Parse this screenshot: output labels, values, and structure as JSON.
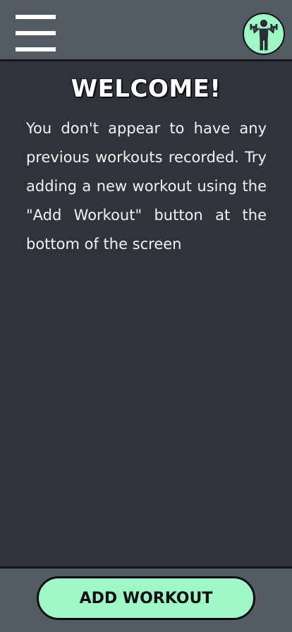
{
  "colors": {
    "header_bg": "#545b62",
    "content_bg": "#2f343b",
    "accent": "#a0f7c6",
    "text": "#ffffff",
    "border": "#15181c"
  },
  "header": {
    "menu_icon": "hamburger-menu-icon",
    "avatar_icon": "weightlifter-icon"
  },
  "main": {
    "title": "WELCOME!",
    "message": "You don't appear to have any previous workouts recorded. Try adding a new workout using the \"Add Workout\" button at the bottom of the screen"
  },
  "footer": {
    "add_workout_label": "ADD WORKOUT"
  }
}
